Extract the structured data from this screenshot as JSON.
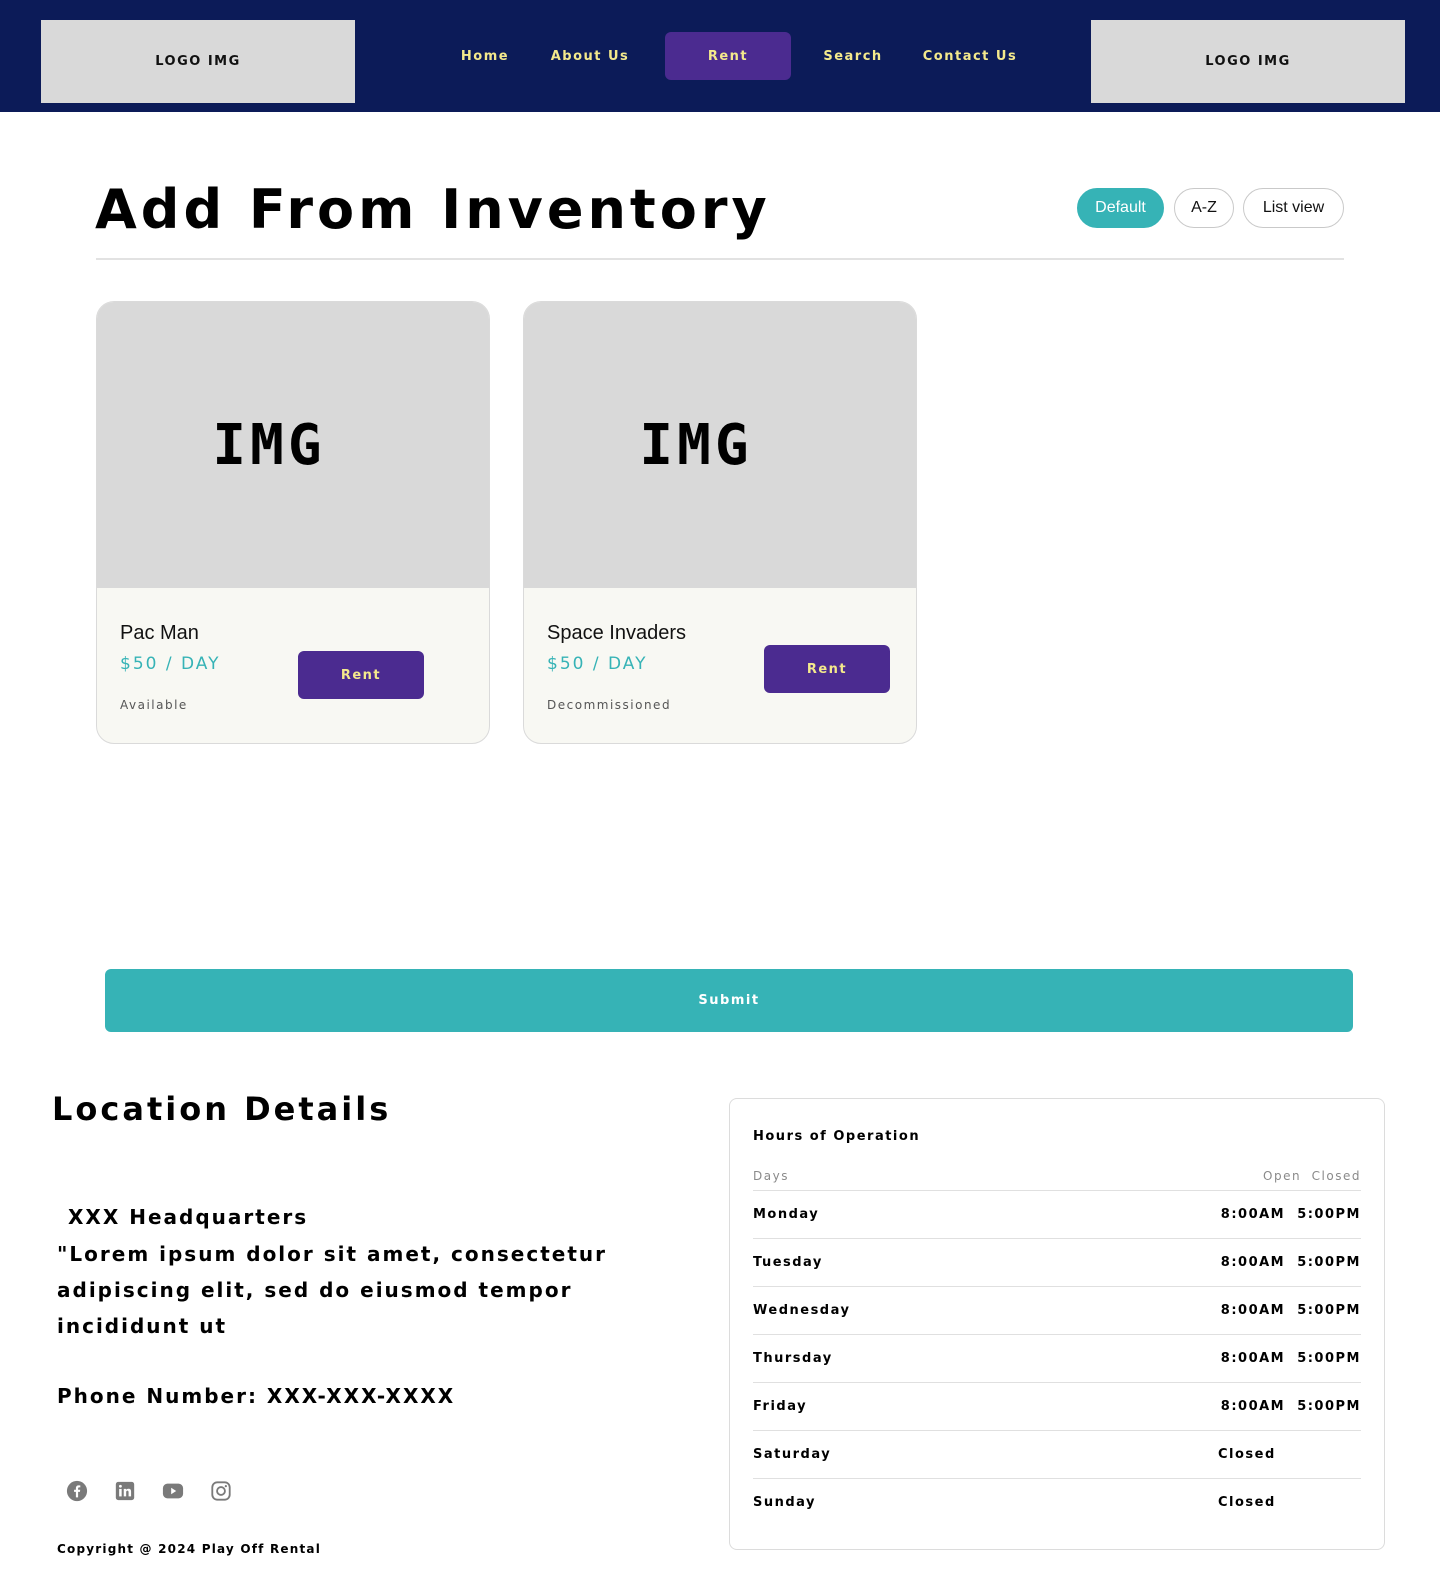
{
  "header": {
    "logo_left": "LOGO IMG",
    "logo_right": "LOGO IMG",
    "nav": {
      "home": "Home",
      "about": "About Us",
      "rent": "Rent",
      "search": "Search",
      "contact": "Contact Us"
    },
    "active_nav": "Rent",
    "bg_color": "#0c1b58",
    "nav_text_color": "#f4e98c",
    "active_bg_color": "#4b2b90"
  },
  "main": {
    "title": "Add From Inventory",
    "sort_buttons": {
      "default": "Default",
      "az": "A-Z",
      "list": "List view"
    },
    "selected_sort": "Default",
    "accent_color": "#36b3b6",
    "items": [
      {
        "image_label": "IMG",
        "name": "Pac Man",
        "price": "$50 / DAY",
        "status": "Available",
        "action": "Rent"
      },
      {
        "image_label": "IMG",
        "name": "Space Invaders",
        "price": "$50 / DAY",
        "status": "Decommissioned",
        "action": "Rent"
      }
    ],
    "submit_label": "Submit"
  },
  "location": {
    "title": "Location Details",
    "headquarters": "XXX Headquarters",
    "description": "\"Lorem ipsum dolor sit amet, consectetur adipiscing elit, sed do eiusmod tempor incididunt ut",
    "phone": "Phone Number: XXX-XXX-XXXX",
    "social_icons": [
      "facebook-icon",
      "linkedin-icon",
      "youtube-icon",
      "instagram-icon"
    ],
    "copyright": "Copyright @ 2024 Play Off Rental"
  },
  "hours": {
    "title": "Hours of Operation",
    "col_days": "Days",
    "col_open_closed": "Open  Closed",
    "rows": [
      {
        "day": "Monday",
        "open": "8:00AM",
        "close": "5:00PM"
      },
      {
        "day": "Tuesday",
        "open": "8:00AM",
        "close": "5:00PM"
      },
      {
        "day": "Wednesday",
        "open": "8:00AM",
        "close": "5:00PM"
      },
      {
        "day": "Thursday",
        "open": "8:00AM",
        "close": "5:00PM"
      },
      {
        "day": "Friday",
        "open": "8:00AM",
        "close": "5:00PM"
      },
      {
        "day": "Saturday",
        "status": "Closed"
      },
      {
        "day": "Sunday",
        "status": "Closed"
      }
    ]
  }
}
